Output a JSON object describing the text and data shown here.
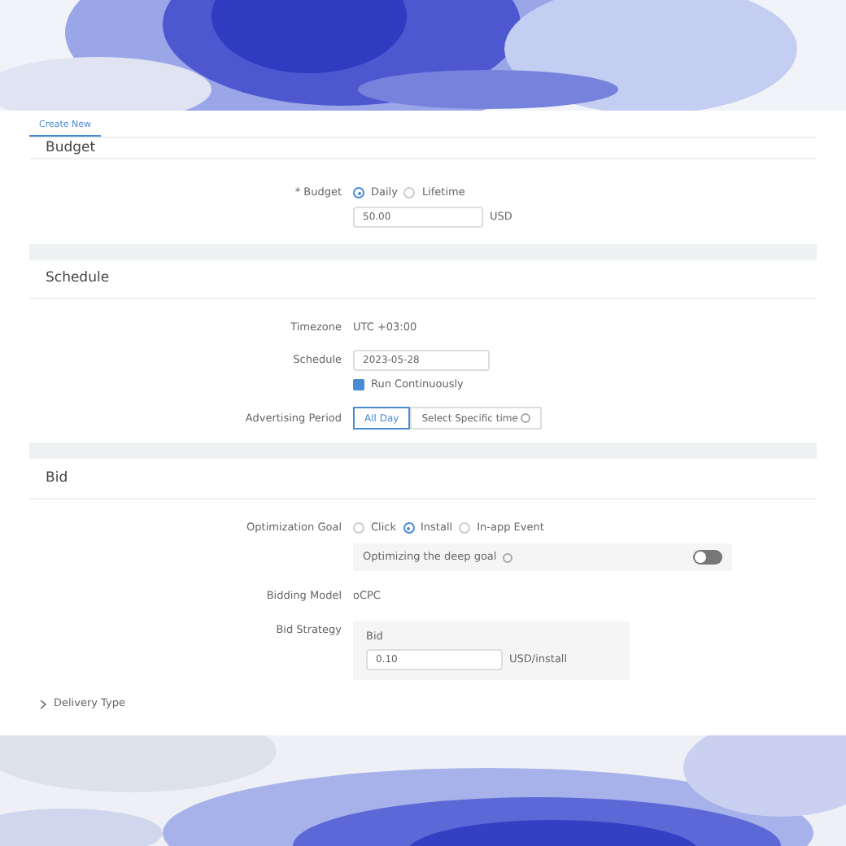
{
  "tab": {
    "label": "Create New",
    "selected": true
  },
  "budget": {
    "title": "Budget",
    "required_mark": "*",
    "label": "Budget",
    "options": [
      {
        "label": "Daily",
        "selected": true
      },
      {
        "label": "Lifetime",
        "selected": false
      }
    ],
    "amount": "50.00",
    "currency": "USD"
  },
  "schedule": {
    "title": "Schedule",
    "timezone_label": "Timezone",
    "timezone": "UTC +03:00",
    "schedule_label": "Schedule",
    "date": "2023-05-28",
    "run_continuously": {
      "label": "Run Continuously",
      "checked": true
    },
    "period_label": "Advertising Period",
    "period_options": [
      {
        "label": "All Day",
        "selected": true,
        "info": false
      },
      {
        "label": "Select Specific time",
        "selected": false,
        "info": true
      }
    ]
  },
  "bid": {
    "title": "Bid",
    "goal_label": "Optimization Goal",
    "goals": [
      {
        "label": "Click",
        "selected": false
      },
      {
        "label": "Install",
        "selected": true
      },
      {
        "label": "In-app Event",
        "selected": false
      }
    ],
    "deep_goal": {
      "label": "Optimizing the deep goal",
      "on": false
    },
    "model_label": "Bidding Model",
    "model": "oCPC",
    "strategy_label": "Bid Strategy",
    "bid_label": "Bid",
    "bid": "0.10",
    "bid_unit": "USD/install"
  },
  "delivery_type": {
    "label": "Delivery Type",
    "expanded": false
  }
}
